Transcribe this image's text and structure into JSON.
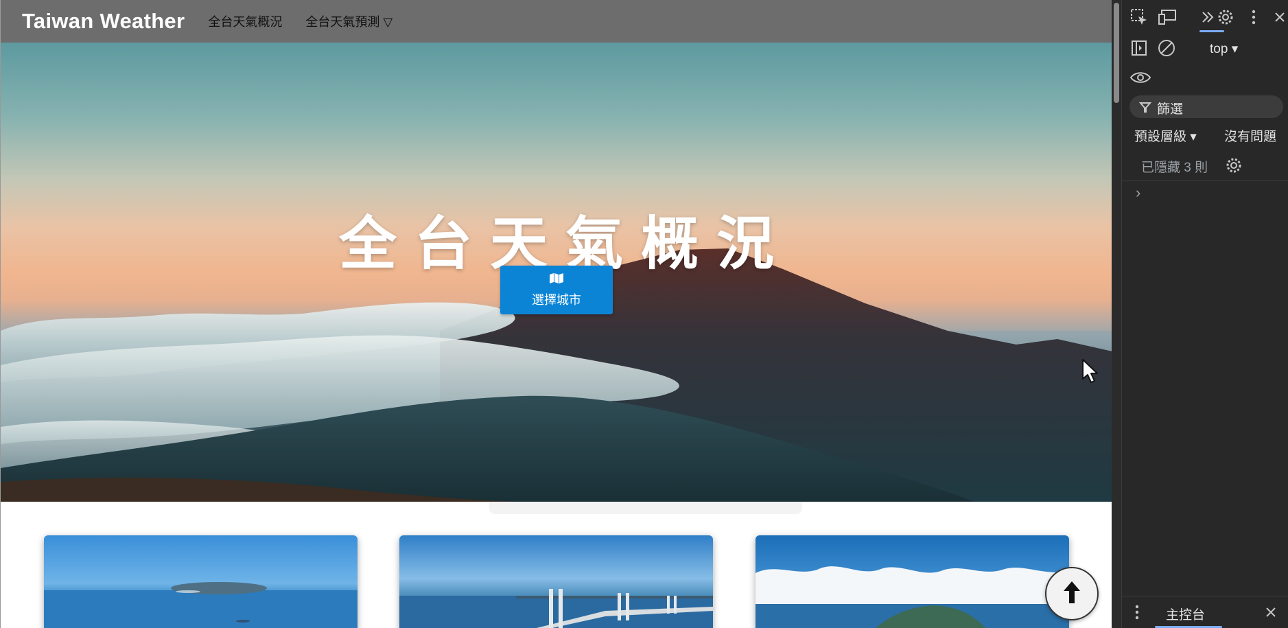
{
  "navbar": {
    "brand": "Taiwan Weather",
    "links": [
      "全台天氣概況",
      "全台天氣預測 ▽"
    ]
  },
  "hero": {
    "title": "全台天氣概況",
    "button_label": "選擇城市",
    "button_icon": "map-icon"
  },
  "cards": [
    {
      "image": "island-on-sea"
    },
    {
      "image": "cable-bridge-over-sea"
    },
    {
      "image": "island-with-clouds"
    }
  ],
  "back_to_top": {
    "icon": "arrow-up-icon"
  },
  "devtools": {
    "context": "top ▾",
    "filter_placeholder": "篩選",
    "level": "預設層級 ▾",
    "issues": "沒有問題",
    "hidden": "已隱藏 3 則",
    "prompt": "›",
    "bottom_tab": "主控台"
  },
  "colors": {
    "navbar_bg": "#6d6d6d",
    "button_blue": "#0c84d6",
    "devtools_bg": "#282828",
    "devtools_accent": "#7cacf8"
  }
}
